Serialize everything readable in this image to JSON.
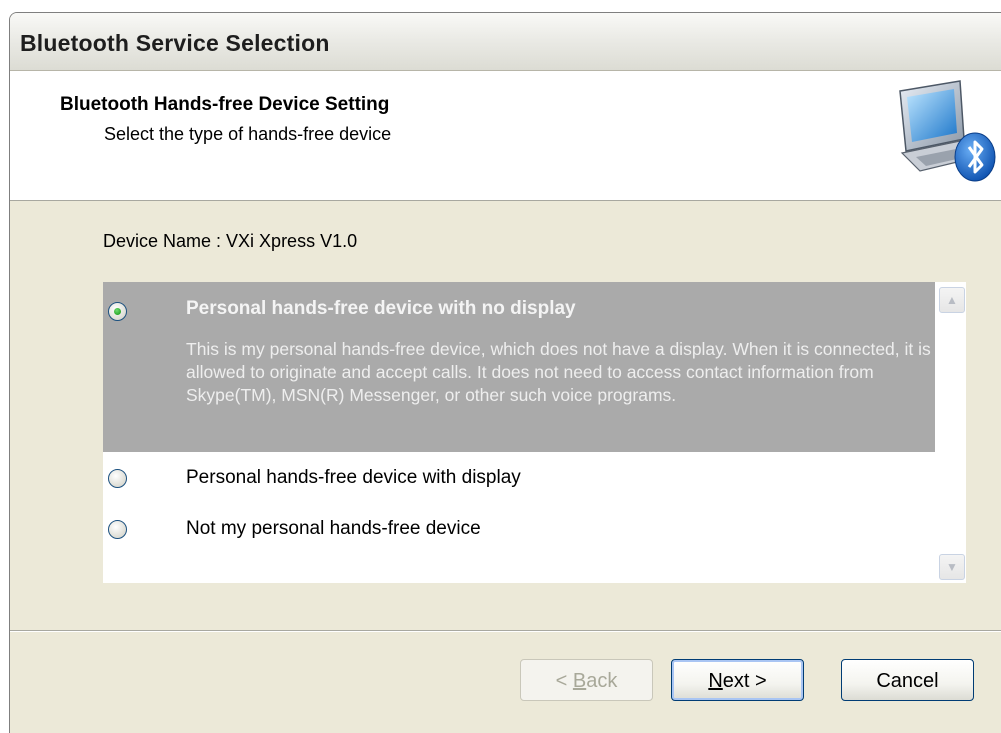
{
  "window": {
    "title": "Bluetooth Service Selection"
  },
  "header": {
    "title": "Bluetooth Hands-free Device Setting",
    "subtitle": "Select the type of hands-free device",
    "icon": "bluetooth-computer-icon"
  },
  "device": {
    "label": "Device Name : VXi Xpress V1.0"
  },
  "options": [
    {
      "title": "Personal hands-free device with no display",
      "description": "This is my personal hands-free device, which does not have a display. When it is connected, it is allowed to originate and accept calls. It does not need to access contact information from Skype(TM), MSN(R) Messenger, or other such voice programs.",
      "selected": true
    },
    {
      "title": "Personal hands-free device with display",
      "selected": false
    },
    {
      "title": "Not my personal hands-free device",
      "selected": false
    }
  ],
  "buttons": {
    "back_prefix": "< ",
    "back_mnemonic": "B",
    "back_rest": "ack",
    "next_mnemonic": "N",
    "next_rest": "ext >",
    "cancel": "Cancel"
  },
  "colors": {
    "selected_row": "#aaaaaa",
    "dialog_bg": "#ece9d8",
    "radio_border": "#1c5180",
    "radio_dot": "#21a121"
  }
}
